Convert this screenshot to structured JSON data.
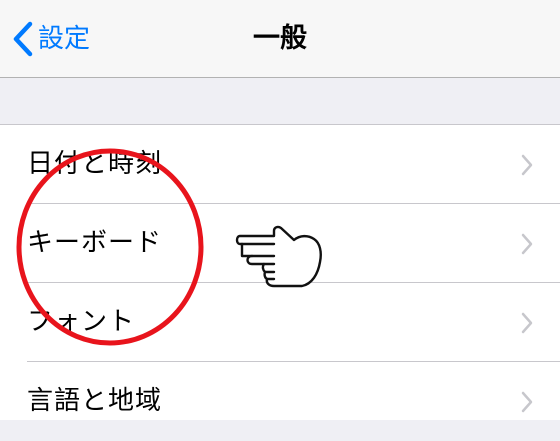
{
  "navbar": {
    "back_label": "設定",
    "title": "一般"
  },
  "settings": {
    "items": [
      {
        "label": "日付と時刻"
      },
      {
        "label": "キーボード"
      },
      {
        "label": "フォント"
      },
      {
        "label": "言語と地域"
      }
    ]
  },
  "colors": {
    "accent": "#007aff",
    "annotation": "#e8141c"
  }
}
